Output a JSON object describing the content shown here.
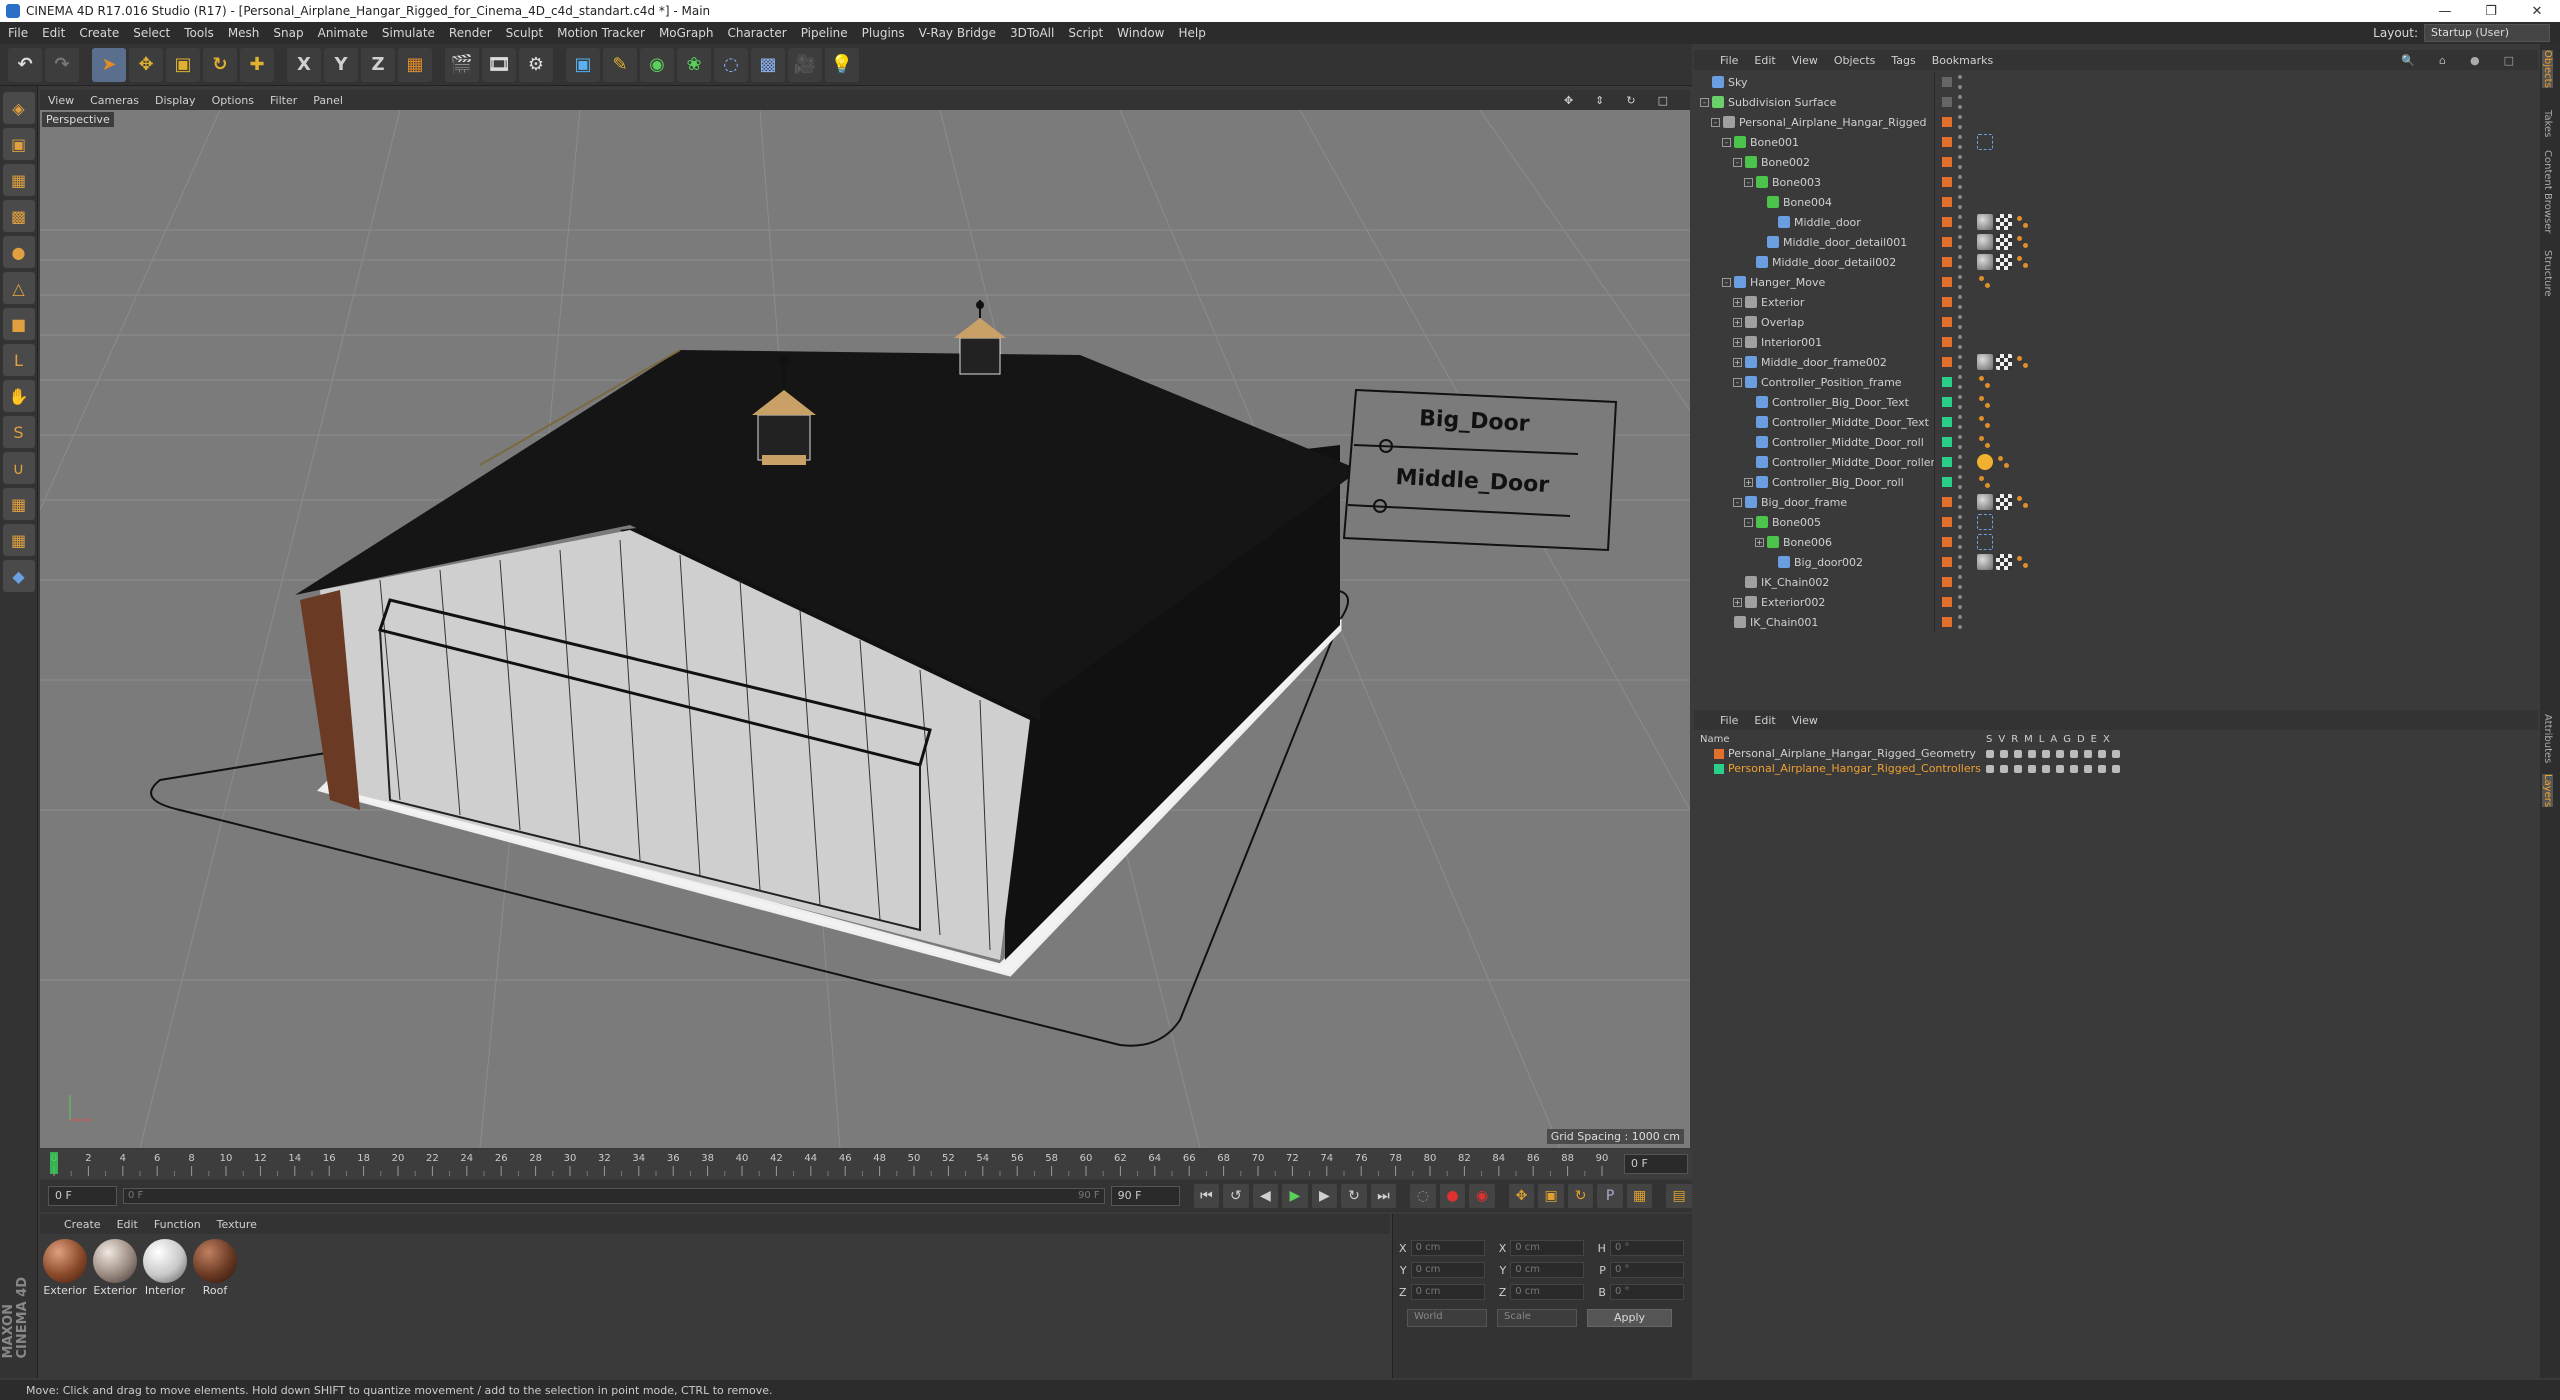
{
  "window": {
    "title": "CINEMA 4D R17.016 Studio (R17) - [Personal_Airplane_Hangar_Rigged_for_Cinema_4D_c4d_standart.c4d *] - Main"
  },
  "menubar": {
    "items": [
      "File",
      "Edit",
      "Create",
      "Select",
      "Tools",
      "Mesh",
      "Snap",
      "Animate",
      "Simulate",
      "Render",
      "Sculpt",
      "Motion Tracker",
      "MoGraph",
      "Character",
      "Pipeline",
      "Plugins",
      "V-Ray Bridge",
      "3DToAll",
      "Script",
      "Window",
      "Help"
    ],
    "layout_label": "Layout:",
    "layout_value": "Startup (User)"
  },
  "toolbar": {
    "axis_labels": [
      "X",
      "Y",
      "Z"
    ]
  },
  "viewport": {
    "menu": [
      "View",
      "Cameras",
      "Display",
      "Options",
      "Filter",
      "Panel"
    ],
    "label": "Perspective",
    "grid_spacing": "Grid Spacing : 1000 cm",
    "sign_big": "Big_Door",
    "sign_middle": "Middle_Door"
  },
  "timeline": {
    "ticks": [
      "0",
      "2",
      "4",
      "6",
      "8",
      "10",
      "12",
      "14",
      "16",
      "18",
      "20",
      "22",
      "24",
      "26",
      "28",
      "30",
      "32",
      "34",
      "36",
      "38",
      "40",
      "42",
      "44",
      "46",
      "48",
      "50",
      "52",
      "54",
      "56",
      "58",
      "60",
      "62",
      "64",
      "66",
      "68",
      "70",
      "72",
      "74",
      "76",
      "78",
      "80",
      "82",
      "84",
      "86",
      "88",
      "90"
    ],
    "frame_right": "0 F",
    "start": "0 F",
    "range_start": "0 F",
    "range_end": "90 F",
    "end": "90 F"
  },
  "materials": {
    "menu": [
      "Create",
      "Edit",
      "Function",
      "Texture"
    ],
    "items": [
      {
        "name": "Exterior",
        "color": "#8a4a2a"
      },
      {
        "name": "Exterior",
        "color": "#9a8a80"
      },
      {
        "name": "Interior",
        "color": "#c8c8c8"
      },
      {
        "name": "Roof",
        "color": "#6a3a24"
      }
    ]
  },
  "coords": {
    "rows": [
      {
        "a": "X",
        "av": "0 cm",
        "b": "X",
        "bv": "0 cm",
        "c": "H",
        "cv": "0 °"
      },
      {
        "a": "Y",
        "av": "0 cm",
        "b": "Y",
        "bv": "0 cm",
        "c": "P",
        "cv": "0 °"
      },
      {
        "a": "Z",
        "av": "0 cm",
        "b": "Z",
        "bv": "0 cm",
        "c": "B",
        "cv": "0 °"
      }
    ],
    "world": "World",
    "scale": "Scale",
    "apply": "Apply"
  },
  "status": "Move: Click and drag to move elements. Hold down SHIFT to quantize movement / add to the selection in point mode, CTRL to remove.",
  "object_manager": {
    "menu": [
      "File",
      "Edit",
      "View",
      "Objects",
      "Tags",
      "Bookmarks"
    ],
    "rows": [
      {
        "name": "Sky",
        "depth": 0,
        "exp": "",
        "icon": "#6a9ee0",
        "layer": "",
        "tags": []
      },
      {
        "name": "Subdivision Surface",
        "depth": 0,
        "exp": "-",
        "icon": "#6ad06a",
        "layer": "",
        "tags": []
      },
      {
        "name": "Personal_Airplane_Hangar_Rigged",
        "depth": 1,
        "exp": "-",
        "icon": "#a0a0a0",
        "layer": "#e0702a",
        "tags": []
      },
      {
        "name": "Bone001",
        "depth": 2,
        "exp": "-",
        "icon": "#4cc44c",
        "layer": "#e0702a",
        "tags": [
          "ik"
        ]
      },
      {
        "name": "Bone002",
        "depth": 3,
        "exp": "-",
        "icon": "#4cc44c",
        "layer": "#e0702a",
        "tags": []
      },
      {
        "name": "Bone003",
        "depth": 4,
        "exp": "-",
        "icon": "#4cc44c",
        "layer": "#e0702a",
        "tags": []
      },
      {
        "name": "Bone004",
        "depth": 5,
        "exp": "",
        "icon": "#4cc44c",
        "layer": "#e0702a",
        "tags": []
      },
      {
        "name": "Middle_door",
        "depth": 6,
        "exp": "",
        "icon": "#6a9ee0",
        "layer": "#e0702a",
        "tags": [
          "mat",
          "uv",
          "dot"
        ]
      },
      {
        "name": "Middle_door_detail001",
        "depth": 5,
        "exp": "",
        "icon": "#6a9ee0",
        "layer": "#e0702a",
        "tags": [
          "mat",
          "uv",
          "dot"
        ]
      },
      {
        "name": "Middle_door_detail002",
        "depth": 4,
        "exp": "",
        "icon": "#6a9ee0",
        "layer": "#e0702a",
        "tags": [
          "mat",
          "uv",
          "dot"
        ]
      },
      {
        "name": "Hanger_Move",
        "depth": 2,
        "exp": "-",
        "icon": "#6a9ee0",
        "layer": "#e0702a",
        "tags": [
          "dot"
        ]
      },
      {
        "name": "Exterior",
        "depth": 3,
        "exp": "+",
        "icon": "#a0a0a0",
        "layer": "#e0702a",
        "tags": []
      },
      {
        "name": "Overlap",
        "depth": 3,
        "exp": "+",
        "icon": "#a0a0a0",
        "layer": "#e0702a",
        "tags": []
      },
      {
        "name": "Interior001",
        "depth": 3,
        "exp": "+",
        "icon": "#a0a0a0",
        "layer": "#e0702a",
        "tags": []
      },
      {
        "name": "Middle_door_frame002",
        "depth": 3,
        "exp": "+",
        "icon": "#6a9ee0",
        "layer": "#e0702a",
        "tags": [
          "mat",
          "uv",
          "dot"
        ]
      },
      {
        "name": "Controller_Position_frame",
        "depth": 3,
        "exp": "-",
        "icon": "#6a9ee0",
        "layer": "#2ad08a",
        "tags": [
          "dot"
        ]
      },
      {
        "name": "Controller_Big_Door_Text",
        "depth": 4,
        "exp": "",
        "icon": "#6a9ee0",
        "layer": "#2ad08a",
        "tags": [
          "dot"
        ]
      },
      {
        "name": "Controller_Middte_Door_Text",
        "depth": 4,
        "exp": "",
        "icon": "#6a9ee0",
        "layer": "#2ad08a",
        "tags": [
          "dot"
        ]
      },
      {
        "name": "Controller_Middte_Door_roll",
        "depth": 4,
        "exp": "",
        "icon": "#6a9ee0",
        "layer": "#2ad08a",
        "tags": [
          "dot"
        ]
      },
      {
        "name": "Controller_Middte_Door_roller",
        "depth": 4,
        "exp": "",
        "icon": "#6a9ee0",
        "layer": "#2ad08a",
        "tags": [
          "prot",
          "dot"
        ]
      },
      {
        "name": "Controller_Big_Door_roll",
        "depth": 4,
        "exp": "+",
        "icon": "#6a9ee0",
        "layer": "#2ad08a",
        "tags": [
          "dot"
        ]
      },
      {
        "name": "Big_door_frame",
        "depth": 3,
        "exp": "-",
        "icon": "#6a9ee0",
        "layer": "#e0702a",
        "tags": [
          "mat",
          "uv",
          "dot"
        ]
      },
      {
        "name": "Bone005",
        "depth": 4,
        "exp": "-",
        "icon": "#4cc44c",
        "layer": "#e0702a",
        "tags": [
          "ik"
        ]
      },
      {
        "name": "Bone006",
        "depth": 5,
        "exp": "+",
        "icon": "#4cc44c",
        "layer": "#e0702a",
        "tags": [
          "ik"
        ]
      },
      {
        "name": "Big_door002",
        "depth": 6,
        "exp": "",
        "icon": "#6a9ee0",
        "layer": "#e0702a",
        "tags": [
          "mat",
          "uv",
          "dot"
        ]
      },
      {
        "name": "IK_Chain002",
        "depth": 3,
        "exp": "",
        "icon": "#a0a0a0",
        "layer": "#e0702a",
        "tags": []
      },
      {
        "name": "Exterior002",
        "depth": 3,
        "exp": "+",
        "icon": "#a0a0a0",
        "layer": "#e0702a",
        "tags": []
      },
      {
        "name": "IK_Chain001",
        "depth": 2,
        "exp": "",
        "icon": "#a0a0a0",
        "layer": "#e0702a",
        "tags": []
      }
    ]
  },
  "layer_manager": {
    "menu": [
      "File",
      "Edit",
      "View"
    ],
    "header_name": "Name",
    "header_cols": [
      "S",
      "V",
      "R",
      "M",
      "L",
      "A",
      "G",
      "D",
      "E",
      "X"
    ],
    "rows": [
      {
        "name": "Personal_Airplane_Hangar_Rigged_Geometry",
        "color": "#e0702a",
        "text": "#d0d0d0"
      },
      {
        "name": "Personal_Airplane_Hangar_Rigged_Controllers",
        "color": "#2ad08a",
        "text": "#f0a030"
      }
    ]
  },
  "right_tabs": [
    "Objects",
    "Takes",
    "Content Browser",
    "Structure",
    "Attributes",
    "Layers"
  ]
}
